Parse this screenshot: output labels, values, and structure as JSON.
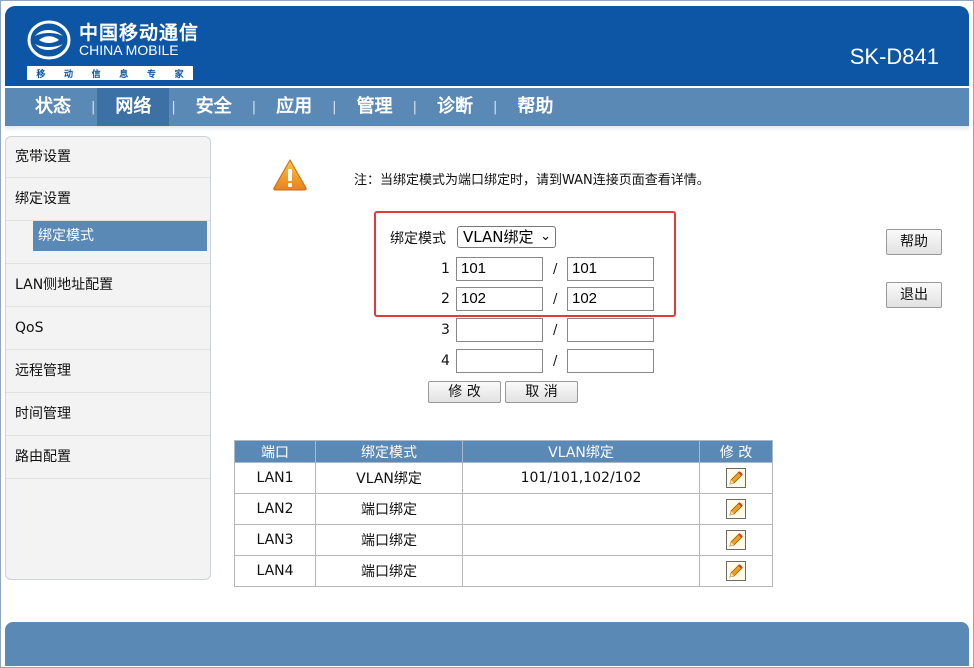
{
  "header": {
    "brand_cn": "中国移动通信",
    "brand_en": "CHINA MOBILE",
    "brand_sub": [
      "移",
      "动",
      "信",
      "息",
      "专",
      "家"
    ],
    "model": "SK-D841"
  },
  "nav": {
    "items": [
      {
        "label": "状态"
      },
      {
        "label": "网络",
        "active": true
      },
      {
        "label": "安全"
      },
      {
        "label": "应用"
      },
      {
        "label": "管理"
      },
      {
        "label": "诊断"
      },
      {
        "label": "帮助"
      }
    ],
    "separator": "|"
  },
  "sidebar": {
    "items": [
      {
        "label": "宽带设置"
      },
      {
        "label": "绑定设置"
      },
      {
        "label": "绑定模式",
        "sub": true,
        "selected": true
      },
      {
        "label": "LAN侧地址配置"
      },
      {
        "label": "QoS"
      },
      {
        "label": "远程管理"
      },
      {
        "label": "时间管理"
      },
      {
        "label": "路由配置"
      }
    ]
  },
  "main": {
    "note": "注：当绑定模式为端口绑定时，请到WAN连接页面查看详情。",
    "bind_mode_label": "绑定模式",
    "bind_mode_value": "VLAN绑定",
    "rows": [
      {
        "index": "1",
        "left": "101",
        "right": "101"
      },
      {
        "index": "2",
        "left": "102",
        "right": "102"
      },
      {
        "index": "3",
        "left": "",
        "right": ""
      },
      {
        "index": "4",
        "left": "",
        "right": ""
      }
    ],
    "slash": "/",
    "modify_button": "修 改",
    "cancel_button": "取 消",
    "help_button": "帮助",
    "exit_button": "退出"
  },
  "table": {
    "headers": [
      "端口",
      "绑定模式",
      "VLAN绑定",
      "修 改"
    ],
    "rows": [
      {
        "port": "LAN1",
        "mode": "VLAN绑定",
        "vlan": "101/101,102/102"
      },
      {
        "port": "LAN2",
        "mode": "端口绑定",
        "vlan": ""
      },
      {
        "port": "LAN3",
        "mode": "端口绑定",
        "vlan": ""
      },
      {
        "port": "LAN4",
        "mode": "端口绑定",
        "vlan": ""
      }
    ],
    "row_icon": "edit-pencil-icon"
  },
  "colors": {
    "header_blue": "#0d56a6",
    "nav_blue": "#5b89b5",
    "nav_active": "#3d71a6",
    "highlight_red": "#e23a3a",
    "warning_orange": "#f29a1e"
  }
}
